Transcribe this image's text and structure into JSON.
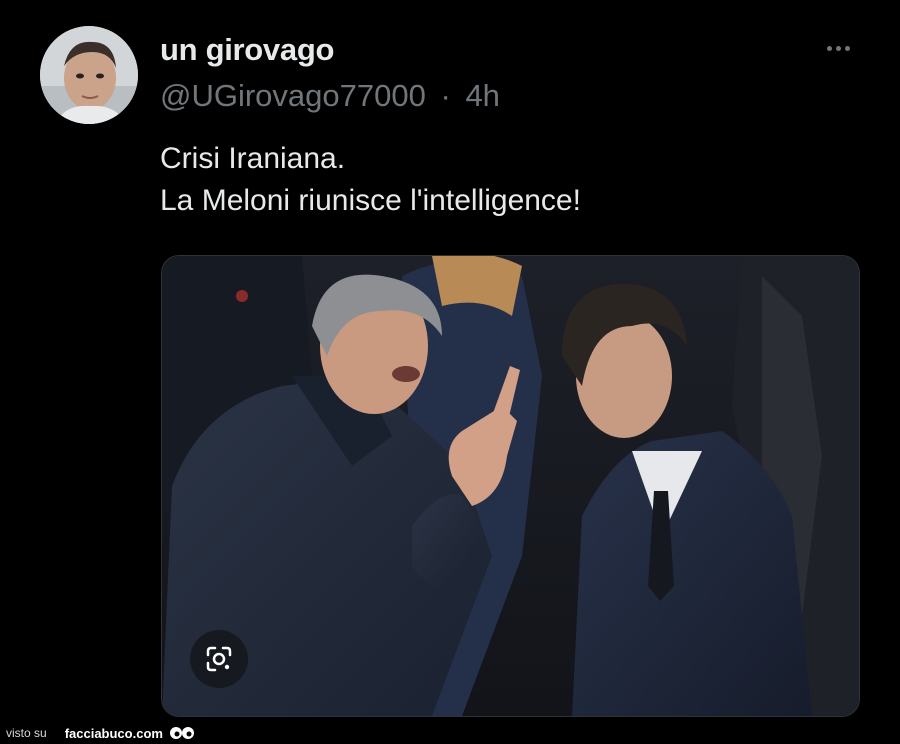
{
  "tweet": {
    "display_name": "un girovago",
    "handle": "@UGirovago77000",
    "separator": "·",
    "time": "4h",
    "text_lines": [
      "Crisi Iraniana.",
      "La Meloni riunisce l'intelligence!"
    ],
    "more_icon": "more-horizontal-icon",
    "lens_icon": "google-lens-icon"
  },
  "watermark": {
    "prefix": "visto su",
    "site": "facciabuco.com"
  },
  "colors": {
    "background": "#000000",
    "primary_text": "#e7e9ea",
    "secondary_text": "#71767b"
  }
}
